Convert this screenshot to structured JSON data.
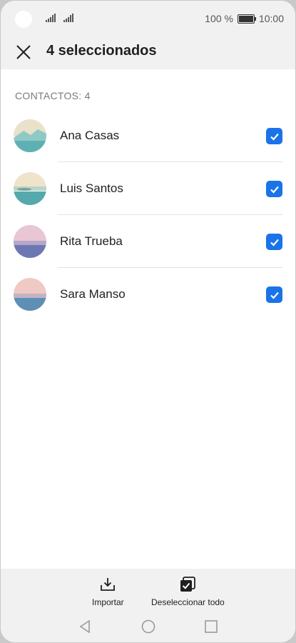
{
  "status_bar": {
    "battery_text": "100 %",
    "time": "10:00"
  },
  "toolbar": {
    "title": "4 seleccionados",
    "close_icon": "close-icon"
  },
  "section": {
    "label": "CONTACTOS: 4"
  },
  "contacts": [
    {
      "name": "Ana Casas",
      "checked": true
    },
    {
      "name": "Luis Santos",
      "checked": true
    },
    {
      "name": "Rita Trueba",
      "checked": true
    },
    {
      "name": "Sara Manso",
      "checked": true
    }
  ],
  "bottom_bar": {
    "import_label": "Importar",
    "deselect_all_label": "Deseleccionar todo"
  },
  "colors": {
    "accent": "#1a73e8",
    "header_bg": "#f1f1f1"
  }
}
